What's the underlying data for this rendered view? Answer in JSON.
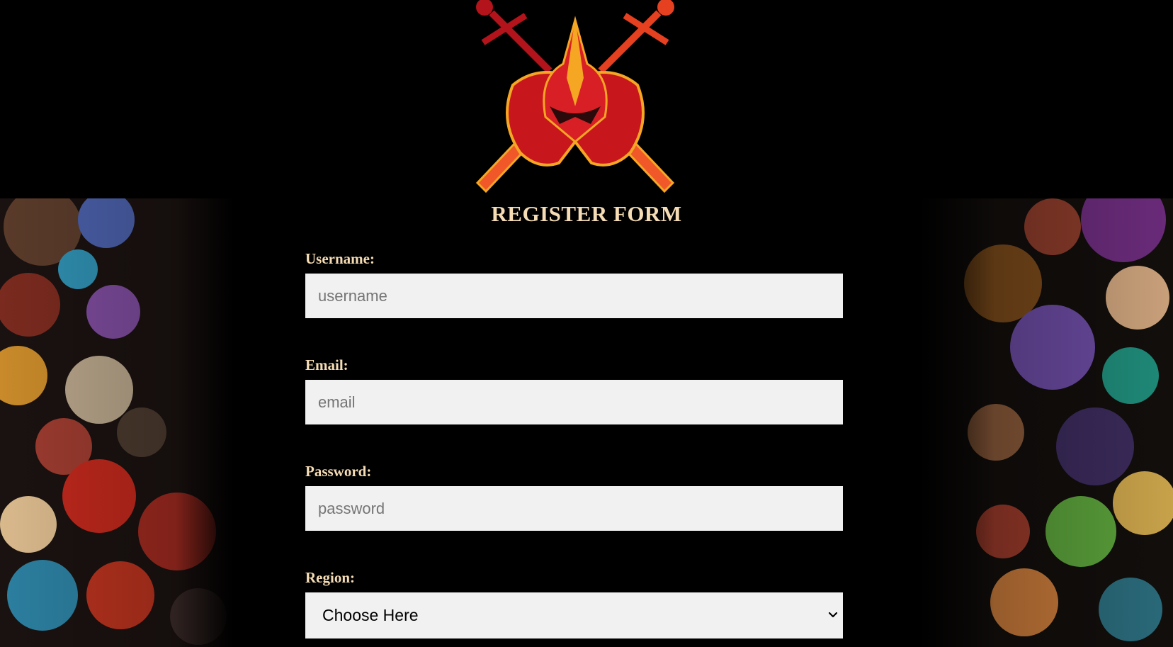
{
  "brand": {
    "logo_icon": "knight-helmet-crossed-swords-icon"
  },
  "form": {
    "title": "REGISTER FORM",
    "username": {
      "label": "Username:",
      "placeholder": "username",
      "value": ""
    },
    "email": {
      "label": "Email:",
      "placeholder": "email",
      "value": ""
    },
    "password": {
      "label": "Password:",
      "placeholder": "password",
      "value": ""
    },
    "region": {
      "label": "Region:",
      "selected": "Choose Here",
      "icon": "chevron-down-icon"
    }
  },
  "colors": {
    "background": "#000000",
    "label": "#f5dcb4",
    "input_bg": "#f1f1f1",
    "logo_red": "#c8161d",
    "logo_orange": "#f0582a",
    "logo_gold": "#f5a623"
  }
}
